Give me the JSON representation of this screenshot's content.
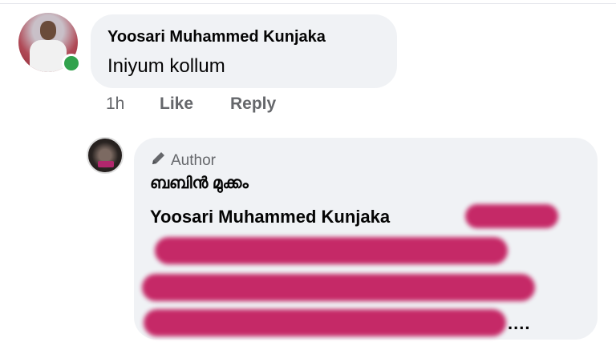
{
  "comment": {
    "author": "Yoosari Muhammed Kunjaka",
    "text": "Iniyum kollum",
    "online": true,
    "time": "1h",
    "like_label": "Like",
    "reply_label": "Reply"
  },
  "reply": {
    "badge": "Author",
    "author": "ബബിൻ മുക്കം",
    "mention": "Yoosari Muhammed Kunjaka",
    "trailing": "....",
    "redacted_color": "#c2185b"
  },
  "colors": {
    "bubble": "#f0f2f5",
    "secondary_text": "#65676b",
    "online": "#31a24c"
  }
}
